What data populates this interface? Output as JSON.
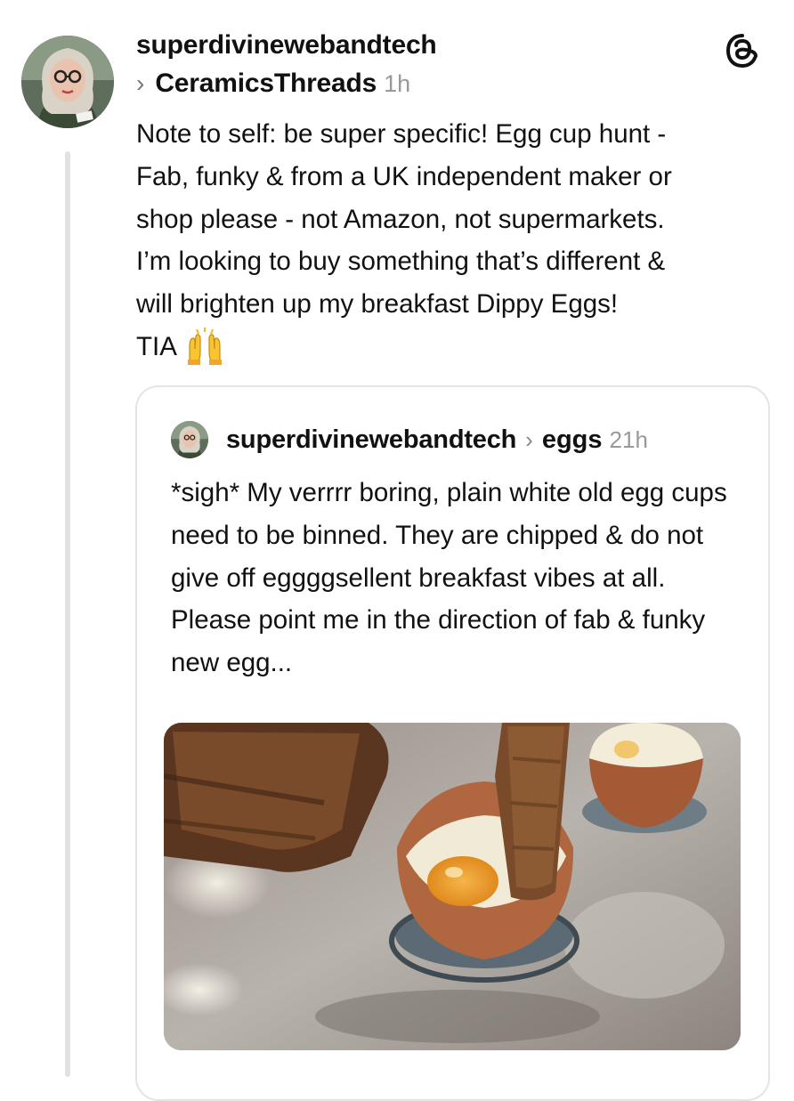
{
  "post": {
    "username": "superdivinewebandtech",
    "community_chevron": "›",
    "community": "CeramicsThreads",
    "time": "1h",
    "body": "Note to self: be super specific! Egg cup hunt -\nFab, funky & from a UK independent maker or\nshop please - not Amazon, not supermarkets.\nI’m looking to buy something that’s different &\nwill brighten up my breakfast Dippy Eggs!",
    "closing": "TIA",
    "closing_emoji": "raised-hands-icon",
    "app_icon": "threads-logo-icon"
  },
  "quoted_post": {
    "username": "superdivinewebandtech",
    "chevron": "›",
    "community": "eggs",
    "time": "21h",
    "body": "*sigh* My verrrr boring, plain white old egg cups need to be binned. They are chipped & do not give off eggggsellent breakfast vibes at all. Please point me in the direction of fab & funky new egg...",
    "image_icon": "boiled-eggs-with-toast-soldiers-photo"
  },
  "colors": {
    "text": "#111111",
    "secondary_text": "#999999",
    "border": "#e4e4e4",
    "thread_line": "#e2e2e2"
  }
}
